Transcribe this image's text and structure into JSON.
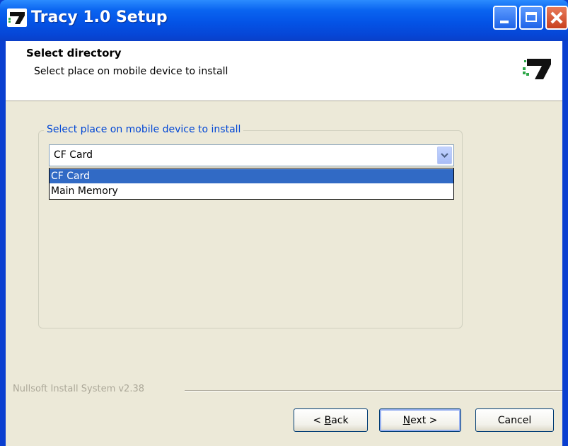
{
  "window": {
    "title": "Tracy 1.0 Setup"
  },
  "header": {
    "title": "Select directory",
    "subtitle": "Select place on mobile device to install"
  },
  "group": {
    "label": "Select place on mobile device to install"
  },
  "combo": {
    "value": "CF Card",
    "options": [
      "CF Card",
      "Main Memory"
    ],
    "highlighted_option": "CF Card"
  },
  "footer": {
    "branding": "Nullsoft Install System v2.38"
  },
  "buttons": {
    "back_prefix": "< ",
    "back_accel": "B",
    "back_suffix": "ack",
    "next_accel": "N",
    "next_suffix": "ext >",
    "cancel": "Cancel"
  },
  "colors": {
    "titlebar": "#0a56e6",
    "dialog_bg": "#ece9d8",
    "selection": "#316ac5",
    "group_label": "#0046d5"
  },
  "icons": {
    "app": "tracy-logo-icon",
    "header_logo": "tracy-logo-icon",
    "combo_arrow": "chevron-down-icon"
  }
}
